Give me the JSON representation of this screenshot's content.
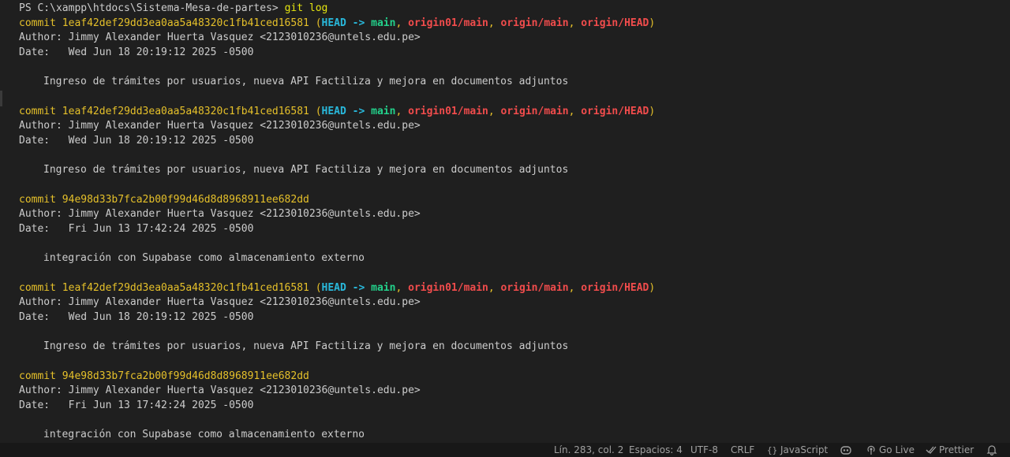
{
  "terminal": {
    "prompt": "PS C:\\xampp\\htdocs\\Sistema-Mesa-de-partes>",
    "command": "git log",
    "entries": [
      {
        "commit_label": "commit",
        "hash": "1eaf42def29dd3ea0aa5a48320c1fb41ced16581",
        "refs_open": "(",
        "ref_head": "HEAD",
        "ref_arrow": "->",
        "ref_main": "main",
        "ref_comma1": ",",
        "ref_origin01": "origin01/main",
        "ref_comma2": ",",
        "ref_origin_main": "origin/main",
        "ref_comma3": ",",
        "ref_origin_head": "origin/HEAD",
        "refs_close": ")",
        "author": "Author: Jimmy Alexander Huerta Vasquez <2123010236@untels.edu.pe>",
        "date": "Date:   Wed Jun 18 20:19:12 2025 -0500",
        "message": "Ingreso de trámites por usuarios, nueva API Factiliza y mejora en documentos adjuntos"
      },
      {
        "commit_label": "commit",
        "hash": "1eaf42def29dd3ea0aa5a48320c1fb41ced16581",
        "refs_open": "(",
        "ref_head": "HEAD",
        "ref_arrow": "->",
        "ref_main": "main",
        "ref_comma1": ",",
        "ref_origin01": "origin01/main",
        "ref_comma2": ",",
        "ref_origin_main": "origin/main",
        "ref_comma3": ",",
        "ref_origin_head": "origin/HEAD",
        "refs_close": ")",
        "author": "Author: Jimmy Alexander Huerta Vasquez <2123010236@untels.edu.pe>",
        "date": "Date:   Wed Jun 18 20:19:12 2025 -0500",
        "message": "Ingreso de trámites por usuarios, nueva API Factiliza y mejora en documentos adjuntos"
      },
      {
        "commit_label": "commit",
        "hash": "94e98d33b7fca2b00f99d46d8d8968911ee682dd",
        "author": "Author: Jimmy Alexander Huerta Vasquez <2123010236@untels.edu.pe>",
        "date": "Date:   Fri Jun 13 17:42:24 2025 -0500",
        "message": "integración con Supabase como almacenamiento externo"
      },
      {
        "commit_label": "commit",
        "hash": "1eaf42def29dd3ea0aa5a48320c1fb41ced16581",
        "refs_open": "(",
        "ref_head": "HEAD",
        "ref_arrow": "->",
        "ref_main": "main",
        "ref_comma1": ",",
        "ref_origin01": "origin01/main",
        "ref_comma2": ",",
        "ref_origin_main": "origin/main",
        "ref_comma3": ",",
        "ref_origin_head": "origin/HEAD",
        "refs_close": ")",
        "author": "Author: Jimmy Alexander Huerta Vasquez <2123010236@untels.edu.pe>",
        "date": "Date:   Wed Jun 18 20:19:12 2025 -0500",
        "message": "Ingreso de trámites por usuarios, nueva API Factiliza y mejora en documentos adjuntos"
      },
      {
        "commit_label": "commit",
        "hash": "94e98d33b7fca2b00f99d46d8d8968911ee682dd",
        "author": "Author: Jimmy Alexander Huerta Vasquez <2123010236@untels.edu.pe>",
        "date": "Date:   Fri Jun 13 17:42:24 2025 -0500",
        "message": "integración con Supabase como almacenamiento externo"
      }
    ]
  },
  "statusbar": {
    "position": "Lín. 283, col. 2",
    "spaces": "Espacios: 4",
    "encoding": "UTF-8",
    "eol": "CRLF",
    "language": "JavaScript",
    "copilot_icon": "copilot-icon",
    "golive": "Go Live",
    "prettier": "Prettier",
    "bell_icon": "bell-icon"
  },
  "colors": {
    "background": "#1f1f1f",
    "yellow": "#e5c02a",
    "cyan": "#29b8db",
    "green": "#23d18b",
    "red": "#f14c4c"
  }
}
